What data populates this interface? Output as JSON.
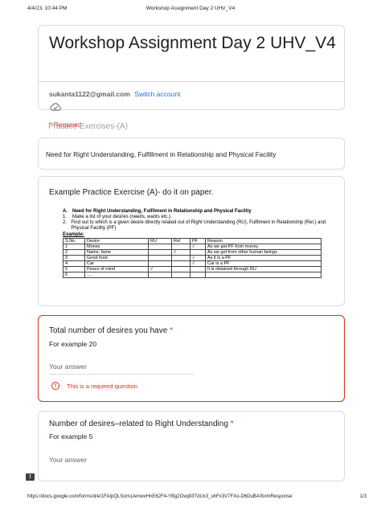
{
  "print_header": {
    "datetime": "4/4/23, 10:44 PM",
    "doc_title": "Workshop Assignment Day 2 UHV_V4"
  },
  "form": {
    "title": "Workshop Assignment Day 2 UHV_V4",
    "email": "sukanta1122@gmail.com",
    "switch_account": "Switch account",
    "cloud_icon": "cloud-done-icon",
    "required_note": "* Required"
  },
  "section": {
    "title": "Practice Exercises-(A)",
    "description": "Need for Right Understanding, Fulfillment in Relationship and Physical Facility"
  },
  "example_card": {
    "title": "Example Practice Exercise (A)- do it on paper.",
    "embed": {
      "heading_num": "A.",
      "heading": "Need for Right Understanding, Fulfilment in Relationship and Physical Facility",
      "step1_num": "1.",
      "step1": "Make a list of your desires (needs, wants etc.).",
      "step2_num": "2.",
      "step2": "Find out to which is a given desire directly related out of Right Understanding (RU), Fulfilment in Relationship (Rel.) and Physical Facility (PF)",
      "example_label": "Example:",
      "table": {
        "headers": [
          "S.No.",
          "Desire",
          "RU",
          "Rel",
          "PF",
          "Reason"
        ],
        "rows": [
          [
            "1",
            "Money",
            "",
            "",
            "√",
            "As we get PF from money"
          ],
          [
            "2",
            "Name, fame",
            "",
            "√",
            "",
            "As we get from other human beings"
          ],
          [
            "3",
            "Good food",
            "",
            "",
            "√",
            "As it is a PF"
          ],
          [
            "4",
            "Car",
            "",
            "",
            "√",
            "Car is a PF"
          ],
          [
            "5",
            "Peace of mind",
            "√",
            "",
            "",
            "It is obtained through RU"
          ],
          [
            "6",
            "....",
            "",
            "",
            "",
            ""
          ]
        ]
      }
    }
  },
  "question1": {
    "title": "Total number of desires you have",
    "star": "*",
    "help": "For example  20",
    "answer_placeholder": "Your answer",
    "error": "This is a required question",
    "error_icon": "!"
  },
  "question2": {
    "title": "Number of desires–related to Right Understanding",
    "star": "*",
    "help": "For example 5",
    "answer_placeholder": "Your answer"
  },
  "feedback_icon": "!",
  "print_footer": {
    "url": "https://docs.google.com/forms/d/e/1FAIpQLSom1ArnwvHnE62F4-YBg2Ovq83TdUx3_uhFx3V7FXo-D6DuBA/formResponse",
    "page": "1/3"
  }
}
